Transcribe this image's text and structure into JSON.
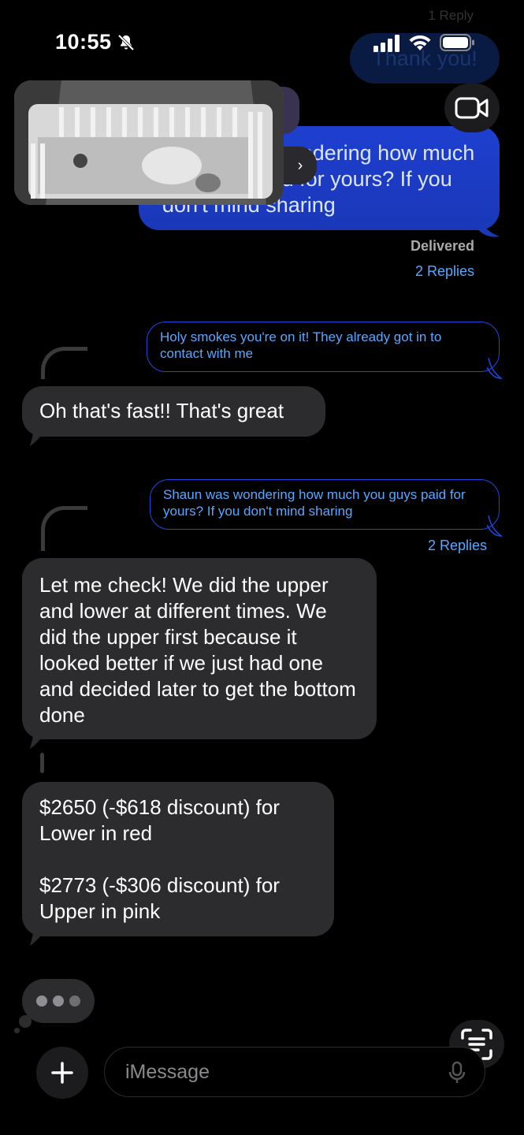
{
  "status_bar": {
    "time": "10:55"
  },
  "faded_top": {
    "reply_count": "1 Reply",
    "bubble_text": "Thank you!"
  },
  "sent_message_top": {
    "text": "Shaun was wondering how much you guys paid for yours? If you don't mind sharing",
    "status": "Delivered",
    "replies": "2 Replies"
  },
  "thread": [
    {
      "quote": "Holy smokes you're on it! They already got in to contact with me",
      "reply": "Oh that's fast!! That's great"
    },
    {
      "quote": "Shaun was wondering how much you guys paid for yours? If you don't mind sharing",
      "replies": "2 Replies",
      "reply": "Let me check! We did the upper and lower at different times. We did the upper first because it looked better if we just had one and decided later to get the bottom done",
      "reply2": "$2650 (-$618 discount) for\nLower in red\n\n$2773 (-$306 discount) for\nUpper in pink"
    }
  ],
  "composer": {
    "placeholder": "iMessage"
  },
  "colors": {
    "accent": "#1b49e6",
    "link": "#5aa7ff",
    "bubble_gray": "#2c2c2e",
    "bubble_blue": "#1e3fd0"
  }
}
